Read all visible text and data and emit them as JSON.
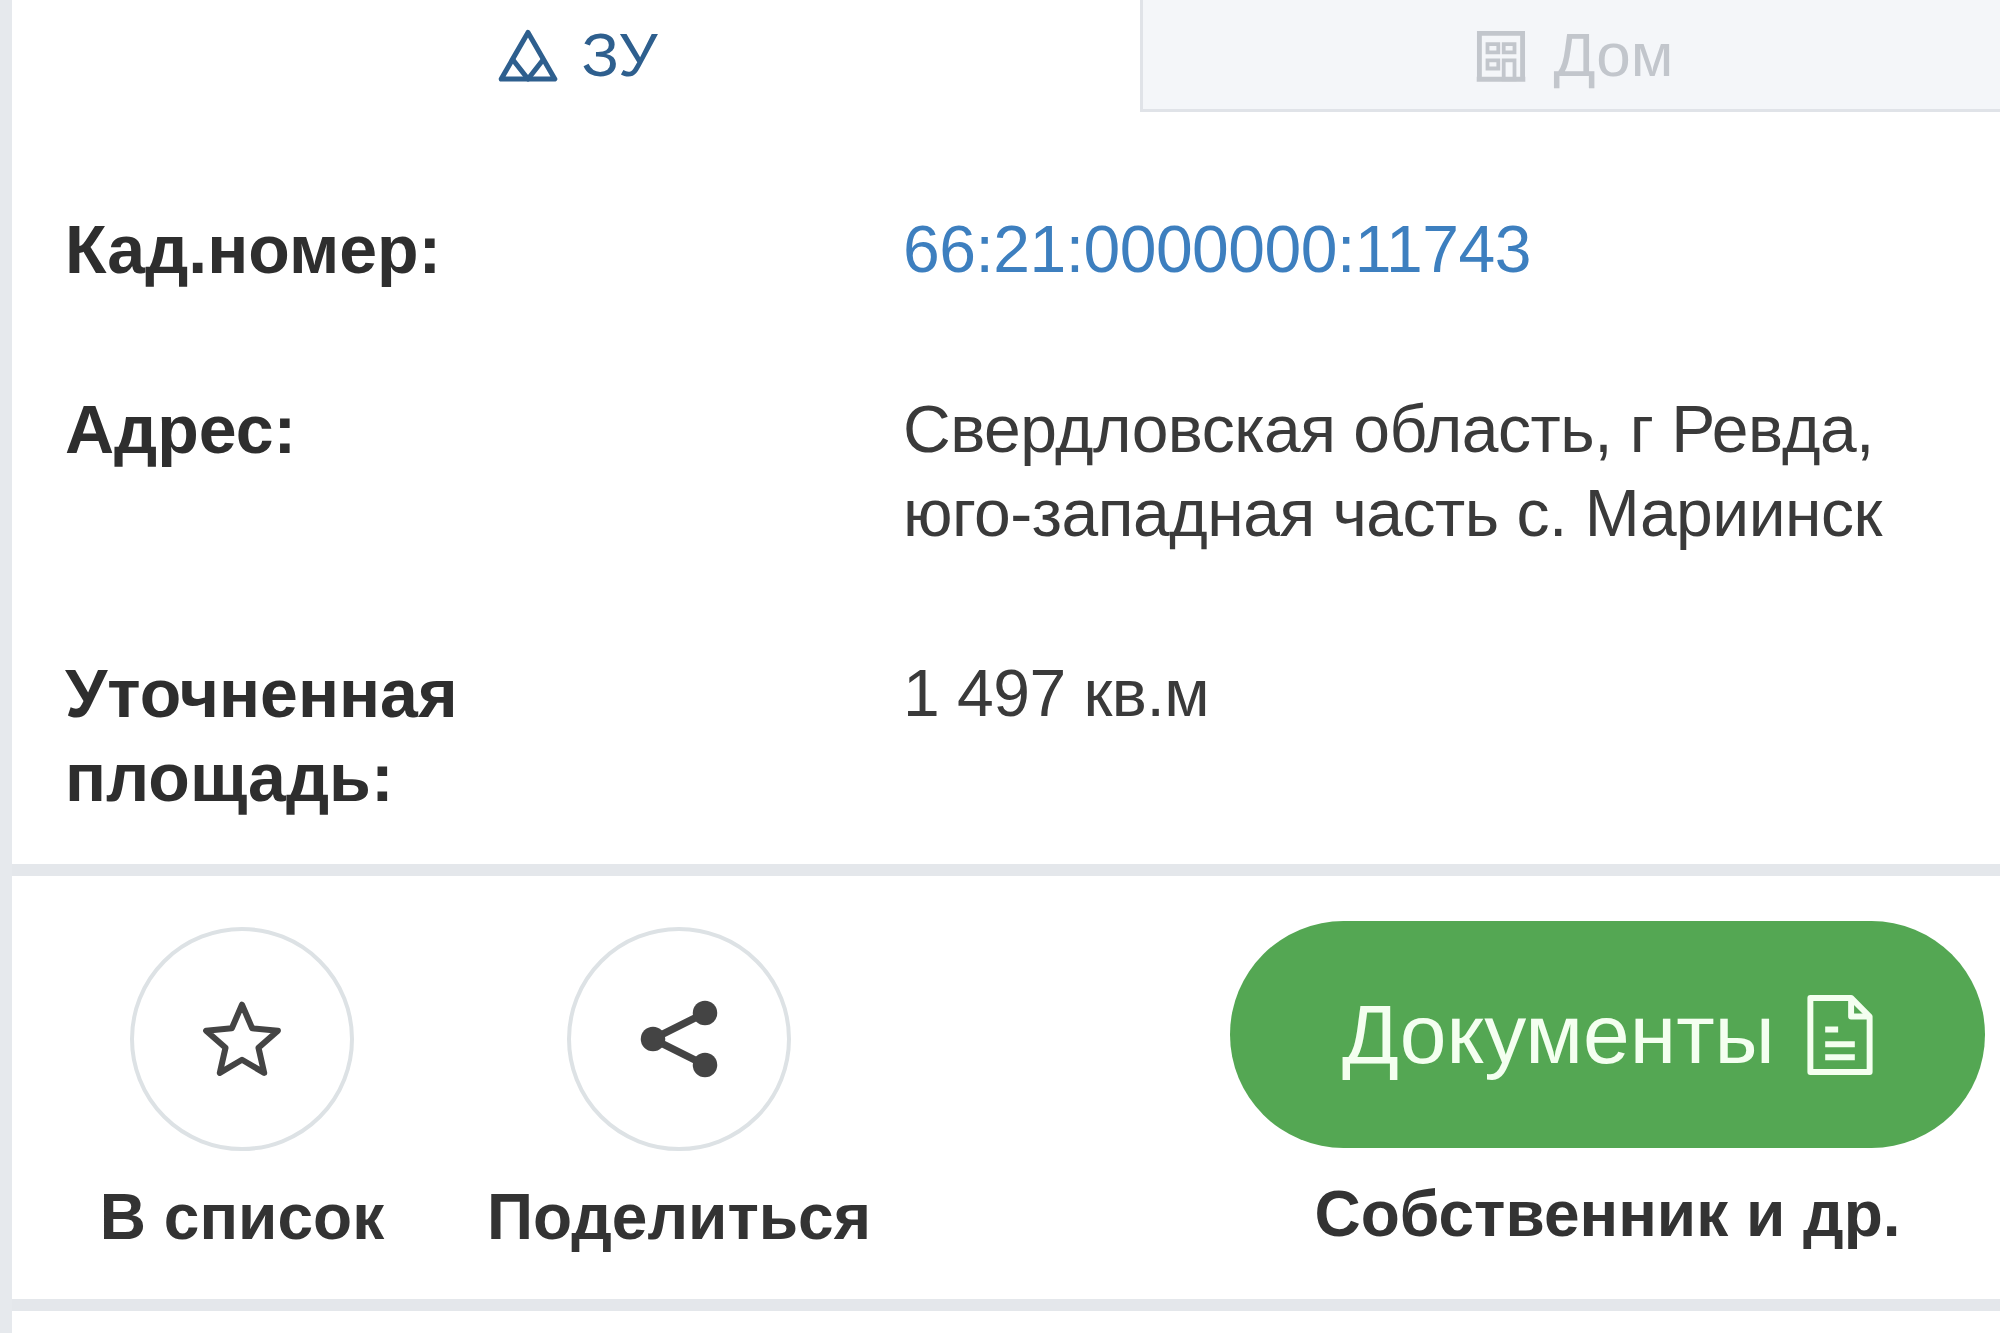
{
  "tabs": [
    {
      "label": "ЗУ",
      "selected": true
    },
    {
      "label": "Дом",
      "selected": false
    }
  ],
  "details": [
    {
      "label": "Кад.номер:",
      "value": "66:21:0000000:11743",
      "kind": "link"
    },
    {
      "label": "Адрес:",
      "value": "Свердловская область, г Ревда, юго-западная часть с. Мариинск",
      "kind": "text"
    },
    {
      "label": "Уточненная площадь:",
      "value": "1 497 кв.м",
      "kind": "text"
    }
  ],
  "actions": [
    {
      "label": "В список"
    },
    {
      "label": "Поделиться"
    }
  ],
  "documents_button": {
    "label": "Документы",
    "caption": "Собственник и др."
  }
}
